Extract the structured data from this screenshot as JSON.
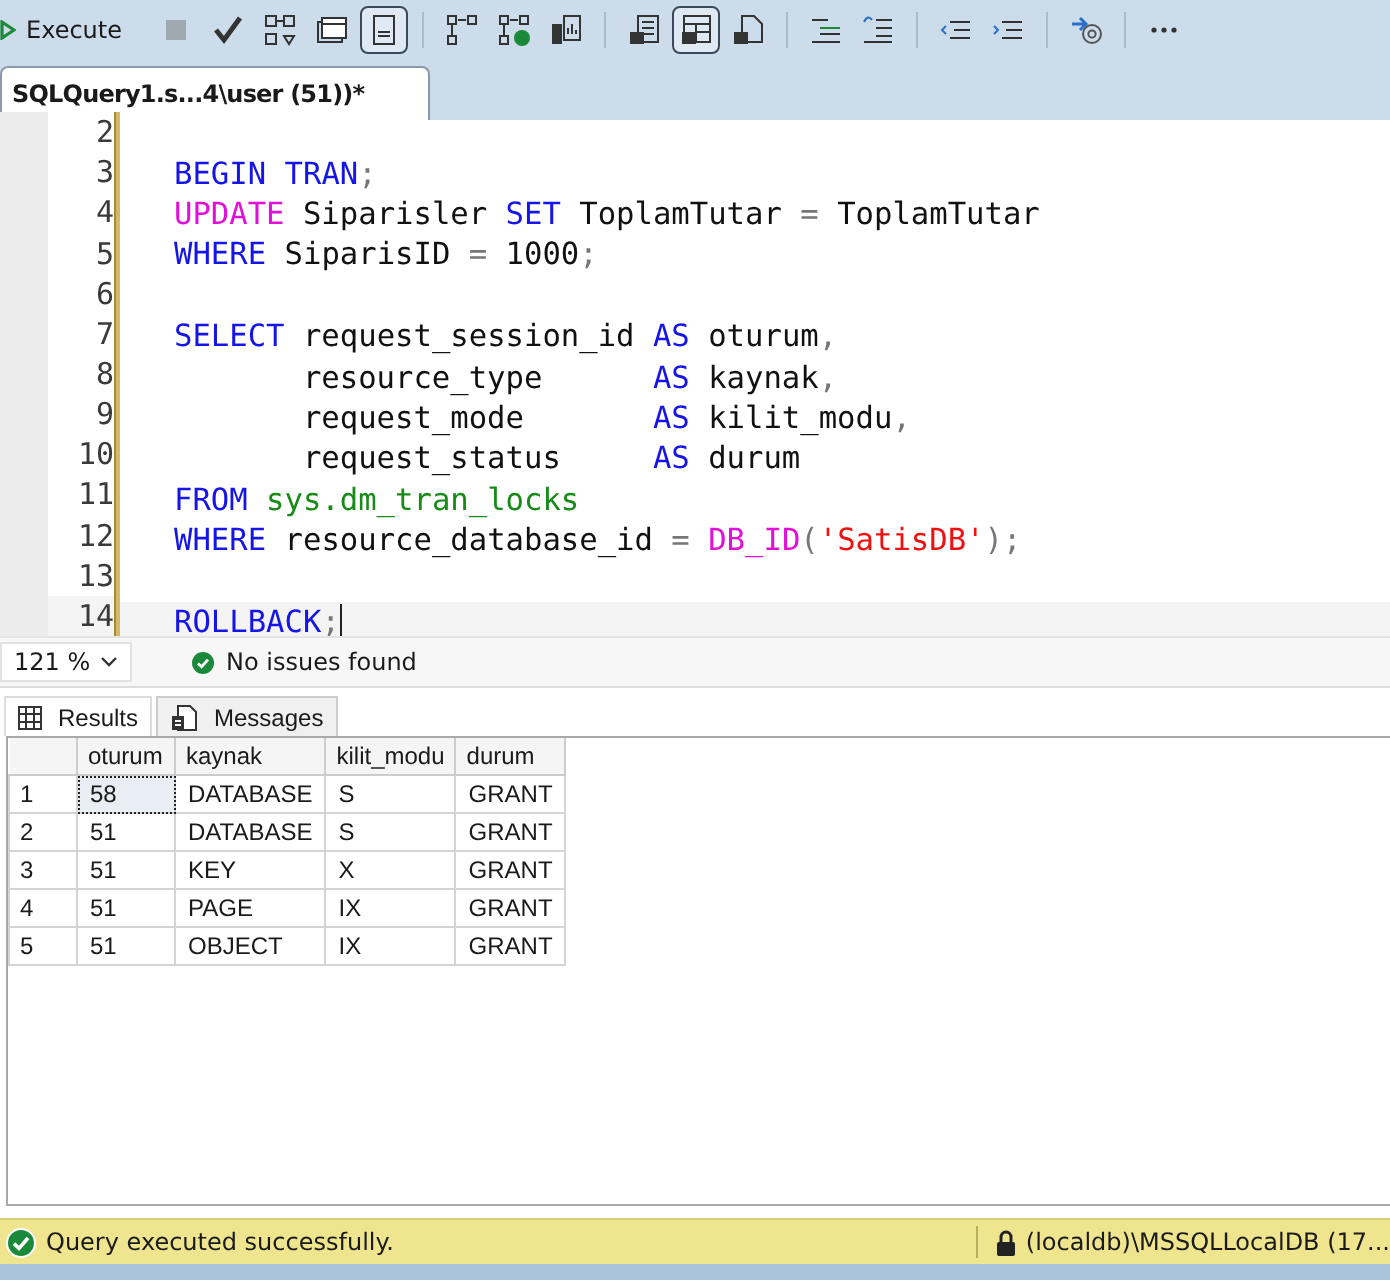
{
  "toolbar": {
    "execute_label": "Execute",
    "groups": [
      [
        {
          "selected": false
        },
        {
          "selected": false
        },
        {
          "selected": false
        },
        {
          "selected": false
        },
        {
          "selected": true
        }
      ],
      [
        {
          "selected": false
        },
        {
          "selected": false
        },
        {
          "selected": false
        }
      ],
      [
        {
          "selected": false
        },
        {
          "selected": true
        },
        {
          "selected": false
        }
      ],
      [
        {
          "selected": false
        },
        {
          "selected": false
        }
      ],
      [
        {
          "selected": false
        },
        {
          "selected": false
        }
      ],
      [
        {
          "selected": false
        }
      ],
      [
        {
          "selected": false
        }
      ]
    ]
  },
  "document_tab": {
    "title": "SQLQuery1.s...4\\user (51))*",
    "selected": true
  },
  "editor": {
    "lines": [
      {
        "number": "2",
        "current": false
      },
      {
        "number": "3",
        "current": false,
        "tokens": [
          {
            "kind": "keyword",
            "text": "BEGIN"
          },
          {
            "kind": "keyword",
            "text": " TRAN"
          },
          {
            "kind": "operator",
            "text": ";"
          }
        ]
      },
      {
        "number": "4",
        "current": false,
        "tokens": [
          {
            "kind": "function",
            "text": "UPDATE"
          },
          {
            "kind": "plain",
            "text": " Siparisler "
          },
          {
            "kind": "keyword",
            "text": "SET"
          },
          {
            "kind": "plain",
            "text": " ToplamTutar "
          },
          {
            "kind": "operator",
            "text": "="
          },
          {
            "kind": "plain",
            "text": " ToplamTutar"
          }
        ]
      },
      {
        "number": "5",
        "current": false,
        "tokens": [
          {
            "kind": "keyword",
            "text": "WHERE"
          },
          {
            "kind": "plain",
            "text": " SiparisID "
          },
          {
            "kind": "operator",
            "text": "="
          },
          {
            "kind": "plain",
            "text": " 1000"
          },
          {
            "kind": "operator",
            "text": ";"
          }
        ]
      },
      {
        "number": "6",
        "current": false
      },
      {
        "number": "7",
        "current": false,
        "tokens": [
          {
            "kind": "keyword",
            "text": "SELECT"
          },
          {
            "kind": "plain",
            "text": " request_session_id "
          },
          {
            "kind": "keyword",
            "text": "AS"
          },
          {
            "kind": "plain",
            "text": " oturum"
          },
          {
            "kind": "operator",
            "text": ","
          }
        ]
      },
      {
        "number": "8",
        "current": false,
        "tokens": [
          {
            "kind": "plain",
            "text": "       resource_type      "
          },
          {
            "kind": "keyword",
            "text": "AS"
          },
          {
            "kind": "plain",
            "text": " kaynak"
          },
          {
            "kind": "operator",
            "text": ","
          }
        ]
      },
      {
        "number": "9",
        "current": false,
        "tokens": [
          {
            "kind": "plain",
            "text": "       request_mode       "
          },
          {
            "kind": "keyword",
            "text": "AS"
          },
          {
            "kind": "plain",
            "text": " kilit_modu"
          },
          {
            "kind": "operator",
            "text": ","
          }
        ]
      },
      {
        "number": "10",
        "current": false,
        "tokens": [
          {
            "kind": "plain",
            "text": "       request_status     "
          },
          {
            "kind": "keyword",
            "text": "AS"
          },
          {
            "kind": "plain",
            "text": " durum"
          }
        ]
      },
      {
        "number": "11",
        "current": false,
        "tokens": [
          {
            "kind": "keyword",
            "text": "FROM"
          },
          {
            "kind": "system",
            "text": " sys.dm_tran_locks"
          }
        ]
      },
      {
        "number": "12",
        "current": false,
        "tokens": [
          {
            "kind": "keyword",
            "text": "WHERE"
          },
          {
            "kind": "plain",
            "text": " resource_database_id "
          },
          {
            "kind": "operator",
            "text": "="
          },
          {
            "kind": "function",
            "text": " DB_ID"
          },
          {
            "kind": "operator",
            "text": "("
          },
          {
            "kind": "string",
            "text": "'SatisDB'"
          },
          {
            "kind": "operator",
            "text": ");"
          }
        ]
      },
      {
        "number": "13",
        "current": false
      },
      {
        "number": "14",
        "current": true,
        "tokens": [
          {
            "kind": "keyword",
            "text": "ROLLBACK"
          },
          {
            "kind": "operator",
            "text": ";"
          }
        ]
      }
    ]
  },
  "zoom": {
    "value": "121 %"
  },
  "issues": {
    "text": "No issues found"
  },
  "result_tabs": [
    {
      "label": "Results",
      "selected": true
    },
    {
      "label": "Messages",
      "selected": false
    }
  ],
  "grid": {
    "columns": [
      "oturum",
      "kaynak",
      "kilit_modu",
      "durum"
    ],
    "rows": [
      {
        "number": "1",
        "focused": true,
        "cells": [
          "58",
          "DATABASE",
          "S",
          "GRANT"
        ]
      },
      {
        "number": "2",
        "focused": false,
        "cells": [
          "51",
          "DATABASE",
          "S",
          "GRANT"
        ]
      },
      {
        "number": "3",
        "focused": false,
        "cells": [
          "51",
          "KEY",
          "X",
          "GRANT"
        ]
      },
      {
        "number": "4",
        "focused": false,
        "cells": [
          "51",
          "PAGE",
          "IX",
          "GRANT"
        ]
      },
      {
        "number": "5",
        "focused": false,
        "cells": [
          "51",
          "OBJECT",
          "IX",
          "GRANT"
        ]
      }
    ]
  },
  "status_bar": {
    "message": "Query executed successfully.",
    "connection": "(localdb)\\MSSQLLocalDB (17..."
  }
}
